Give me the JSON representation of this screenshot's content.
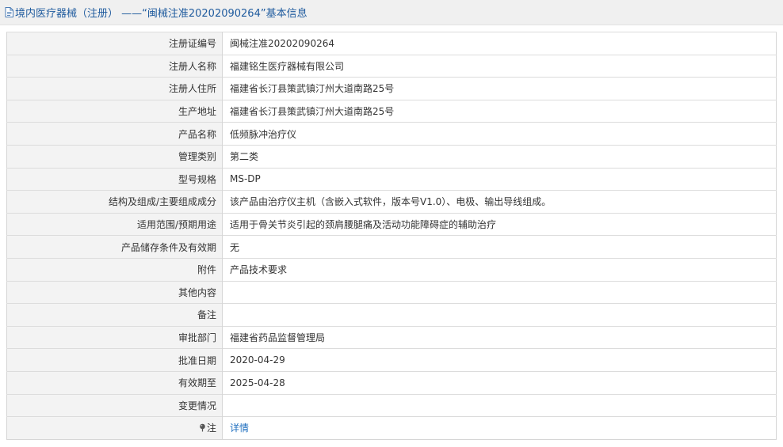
{
  "header": {
    "title": "境内医疗器械（注册） ——“闽械注准20202090264”基本信息"
  },
  "rows": [
    {
      "label": "注册证编号",
      "value": "闽械注准20202090264"
    },
    {
      "label": "注册人名称",
      "value": "福建铭生医疗器械有限公司"
    },
    {
      "label": "注册人住所",
      "value": "福建省长汀县策武镇汀州大道南路25号"
    },
    {
      "label": "生产地址",
      "value": "福建省长汀县策武镇汀州大道南路25号"
    },
    {
      "label": "产品名称",
      "value": "低频脉冲治疗仪"
    },
    {
      "label": "管理类别",
      "value": "第二类"
    },
    {
      "label": "型号规格",
      "value": "MS-DP"
    },
    {
      "label": "结构及组成/主要组成成分",
      "value": "该产品由治疗仪主机（含嵌入式软件，版本号V1.0）、电极、输出导线组成。"
    },
    {
      "label": "适用范围/预期用途",
      "value": "适用于骨关节炎引起的颈肩腰腿痛及活动功能障碍症的辅助治疗"
    },
    {
      "label": "产品储存条件及有效期",
      "value": "无"
    },
    {
      "label": "附件",
      "value": "产品技术要求"
    },
    {
      "label": "其他内容",
      "value": ""
    },
    {
      "label": "备注",
      "value": ""
    },
    {
      "label": "审批部门",
      "value": "福建省药品监督管理局"
    },
    {
      "label": "批准日期",
      "value": "2020-04-29"
    },
    {
      "label": "有效期至",
      "value": "2025-04-28"
    },
    {
      "label": "变更情况",
      "value": ""
    }
  ],
  "note_row": {
    "label": "注",
    "icon": "pin-icon",
    "link_text": "详情"
  },
  "colors": {
    "header_bg": "#f0f0f0",
    "title": "#1f5b9e",
    "label_bg": "#f3f3f3",
    "link": "#1f6fbf",
    "border": "#d6d6d6"
  }
}
